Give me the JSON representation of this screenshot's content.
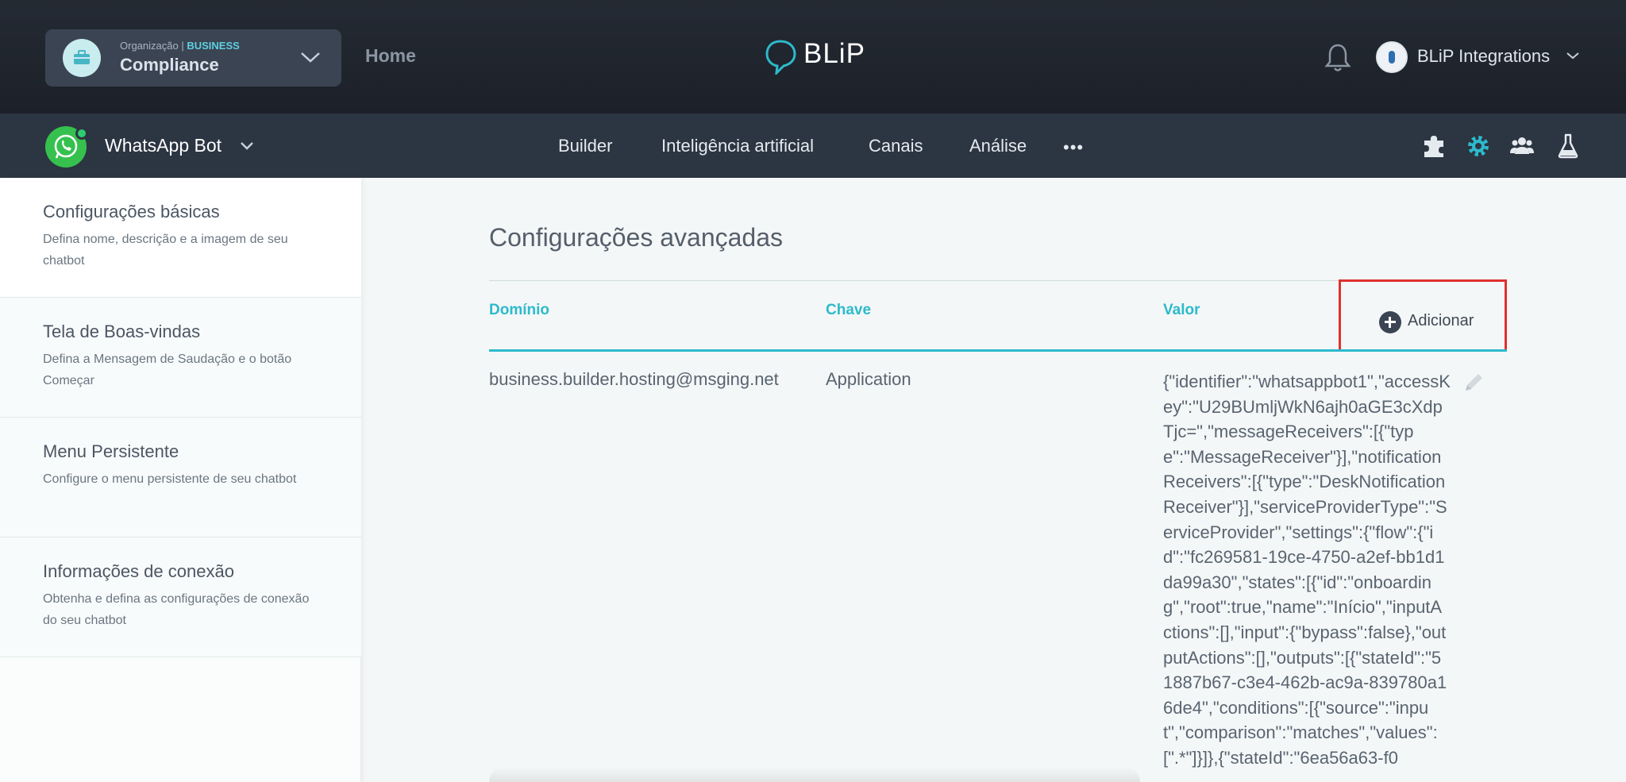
{
  "topbar": {
    "org_label": "Organização |",
    "org_type": "BUSINESS",
    "org_name": "Compliance",
    "home": "Home",
    "logo": "BLiP",
    "user_name": "BLiP Integrations"
  },
  "botbar": {
    "bot_name": "WhatsApp Bot",
    "nav": [
      "Builder",
      "Inteligência artificial",
      "Canais",
      "Análise"
    ],
    "more": "•••",
    "tools": [
      "puzzle-icon",
      "gear-icon",
      "users-icon",
      "flask-icon"
    ],
    "active_tool_color": "#2dbacc"
  },
  "sidebar": {
    "items": [
      {
        "title": "Configurações básicas",
        "desc": "Defina nome, descrição e a imagem de seu chatbot"
      },
      {
        "title": "Tela de Boas-vindas",
        "desc": "Defina a Mensagem de Saudação e o botão Começar"
      },
      {
        "title": "Menu Persistente",
        "desc": "Configure o menu persistente de seu chatbot"
      },
      {
        "title": "Informações de conexão",
        "desc": "Obtenha e defina as configurações de conexão do seu chatbot"
      }
    ]
  },
  "main": {
    "title": "Configurações avançadas",
    "columns": [
      "Domínio",
      "Chave",
      "Valor"
    ],
    "add_label": "Adicionar",
    "rows": [
      {
        "domain": "business.builder.hosting@msging.net",
        "key": "Application",
        "value": "{\"identifier\":\"whatsappbot1\",\"accessKey\":\"U29BUmljWkN6ajh0aGE3cXdpTjc=\",\"messageReceivers\":[{\"type\":\"MessageReceiver\"}],\"notificationReceivers\":[{\"type\":\"DeskNotificationReceiver\"}],\"serviceProviderType\":\"ServiceProvider\",\"settings\":{\"flow\":{\"id\":\"fc269581-19ce-4750-a2ef-bb1d1da99a30\",\"states\":[{\"id\":\"onboarding\",\"root\":true,\"name\":\"Início\",\"inputActions\":[],\"input\":{\"bypass\":false},\"outputActions\":[],\"outputs\":[{\"stateId\":\"51887b67-c3e4-462b-ac9a-839780a16de4\",\"conditions\":[{\"source\":\"input\",\"comparison\":\"matches\",\"values\":[\".*\"]}]},{\"stateId\":\"6ea56a63-f0"
      }
    ]
  },
  "colors": {
    "accent": "#2dbacc",
    "highlight_border": "#e0312e",
    "topbar_bg": "#1f252e",
    "botbar_bg": "#2c3542"
  }
}
